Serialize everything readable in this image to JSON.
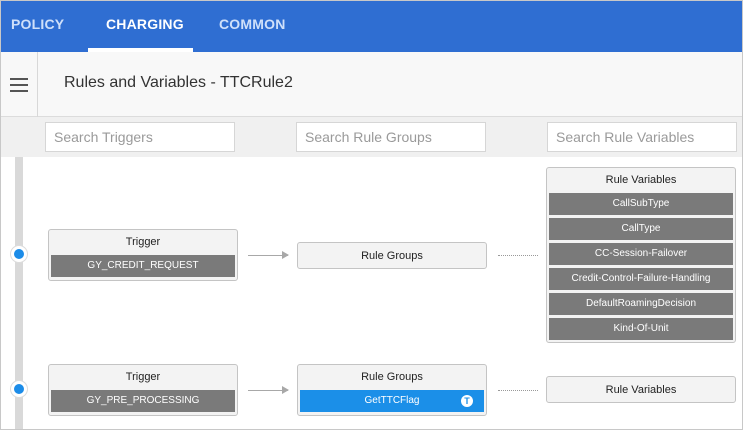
{
  "nav": {
    "tabs": [
      {
        "label": "POLICY"
      },
      {
        "label": "CHARGING"
      },
      {
        "label": "COMMON"
      }
    ],
    "active_tab": "CHARGING"
  },
  "header": {
    "title": "Rules and Variables - TTCRule2"
  },
  "search": {
    "triggers_placeholder": "Search Triggers",
    "rule_groups_placeholder": "Search Rule Groups",
    "rule_variables_placeholder": "Search Rule Variables"
  },
  "flows": [
    {
      "trigger": {
        "heading": "Trigger",
        "name": "GY_CREDIT_REQUEST"
      },
      "rule_groups": {
        "heading": "Rule Groups",
        "items": []
      },
      "rule_variables": {
        "heading": "Rule Variables",
        "items": [
          "CallSubType",
          "CallType",
          "CC-Session-Failover",
          "Credit-Control-Failure-Handling",
          "DefaultRoamingDecision",
          "Kind-Of-Unit"
        ]
      }
    },
    {
      "trigger": {
        "heading": "Trigger",
        "name": "GY_PRE_PROCESSING"
      },
      "rule_groups": {
        "heading": "Rule Groups",
        "items": [
          "GetTTCFlag"
        ],
        "badge": "T"
      },
      "rule_variables": {
        "heading": "Rule Variables",
        "items": []
      }
    }
  ],
  "colors": {
    "nav": "#2f6ed2",
    "selected": "#1b8fe8",
    "item": "#7a7a7a"
  }
}
